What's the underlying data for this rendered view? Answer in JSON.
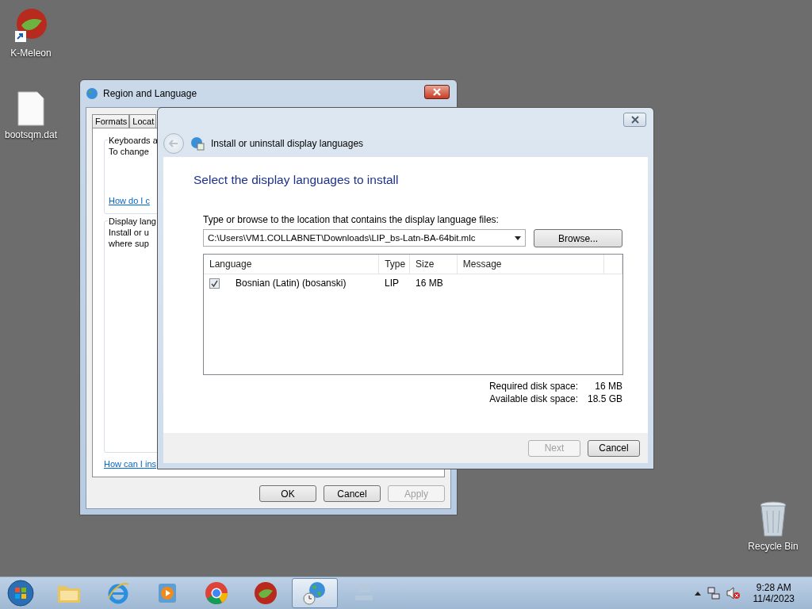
{
  "desktop_icons": [
    {
      "kind": "browser",
      "label": "K-Meleon"
    },
    {
      "kind": "file",
      "label": "bootsqm.dat"
    },
    {
      "kind": "bin",
      "label": "Recycle Bin"
    }
  ],
  "region_window": {
    "title": "Region and Language",
    "tabs": [
      {
        "label": "Formats",
        "selected": false
      },
      {
        "label": "Locat",
        "selected": false
      }
    ],
    "groups": [
      {
        "title": "Keyboards a",
        "lines": [
          "To change"
        ],
        "link": "How do I c"
      },
      {
        "title": "Display lang",
        "lines": [
          "Install or u",
          "where sup"
        ]
      }
    ],
    "link": "How can I ins",
    "buttons": [
      {
        "label": "OK",
        "disabled": false
      },
      {
        "label": "Cancel",
        "disabled": false
      },
      {
        "label": "Apply",
        "disabled": true
      }
    ]
  },
  "install_dialog": {
    "title": "Install or uninstall display languages",
    "heading": "Select the display languages to install",
    "location_label": "Type or browse to the location that contains the display language files:",
    "path": "C:\\Users\\VM1.COLLABNET\\Downloads\\LIP_bs-Latn-BA-64bit.mlc",
    "browse": "Browse...",
    "columns": [
      "Language",
      "Type",
      "Size",
      "Message"
    ],
    "rows": [
      {
        "checked": true,
        "language": "Bosnian (Latin) (bosanski)",
        "type": "LIP",
        "size": "16 MB"
      }
    ],
    "disk": [
      {
        "label": "Required disk space:",
        "value": "16 MB"
      },
      {
        "label": "Available disk space:",
        "value": "18.5 GB"
      }
    ],
    "buttons": [
      {
        "label": "Next",
        "disabled": true
      },
      {
        "label": "Cancel",
        "disabled": false
      }
    ]
  },
  "taskbar": {
    "apps": [
      {
        "kind": "explorer",
        "active": false
      },
      {
        "kind": "ie",
        "active": false
      },
      {
        "kind": "media",
        "active": false
      },
      {
        "kind": "chrome",
        "active": false
      },
      {
        "kind": "browser",
        "active": false
      },
      {
        "kind": "globe",
        "active": true
      },
      {
        "kind": "faded",
        "active": false
      }
    ],
    "time": "9:28 AM",
    "date": "11/4/2023"
  }
}
